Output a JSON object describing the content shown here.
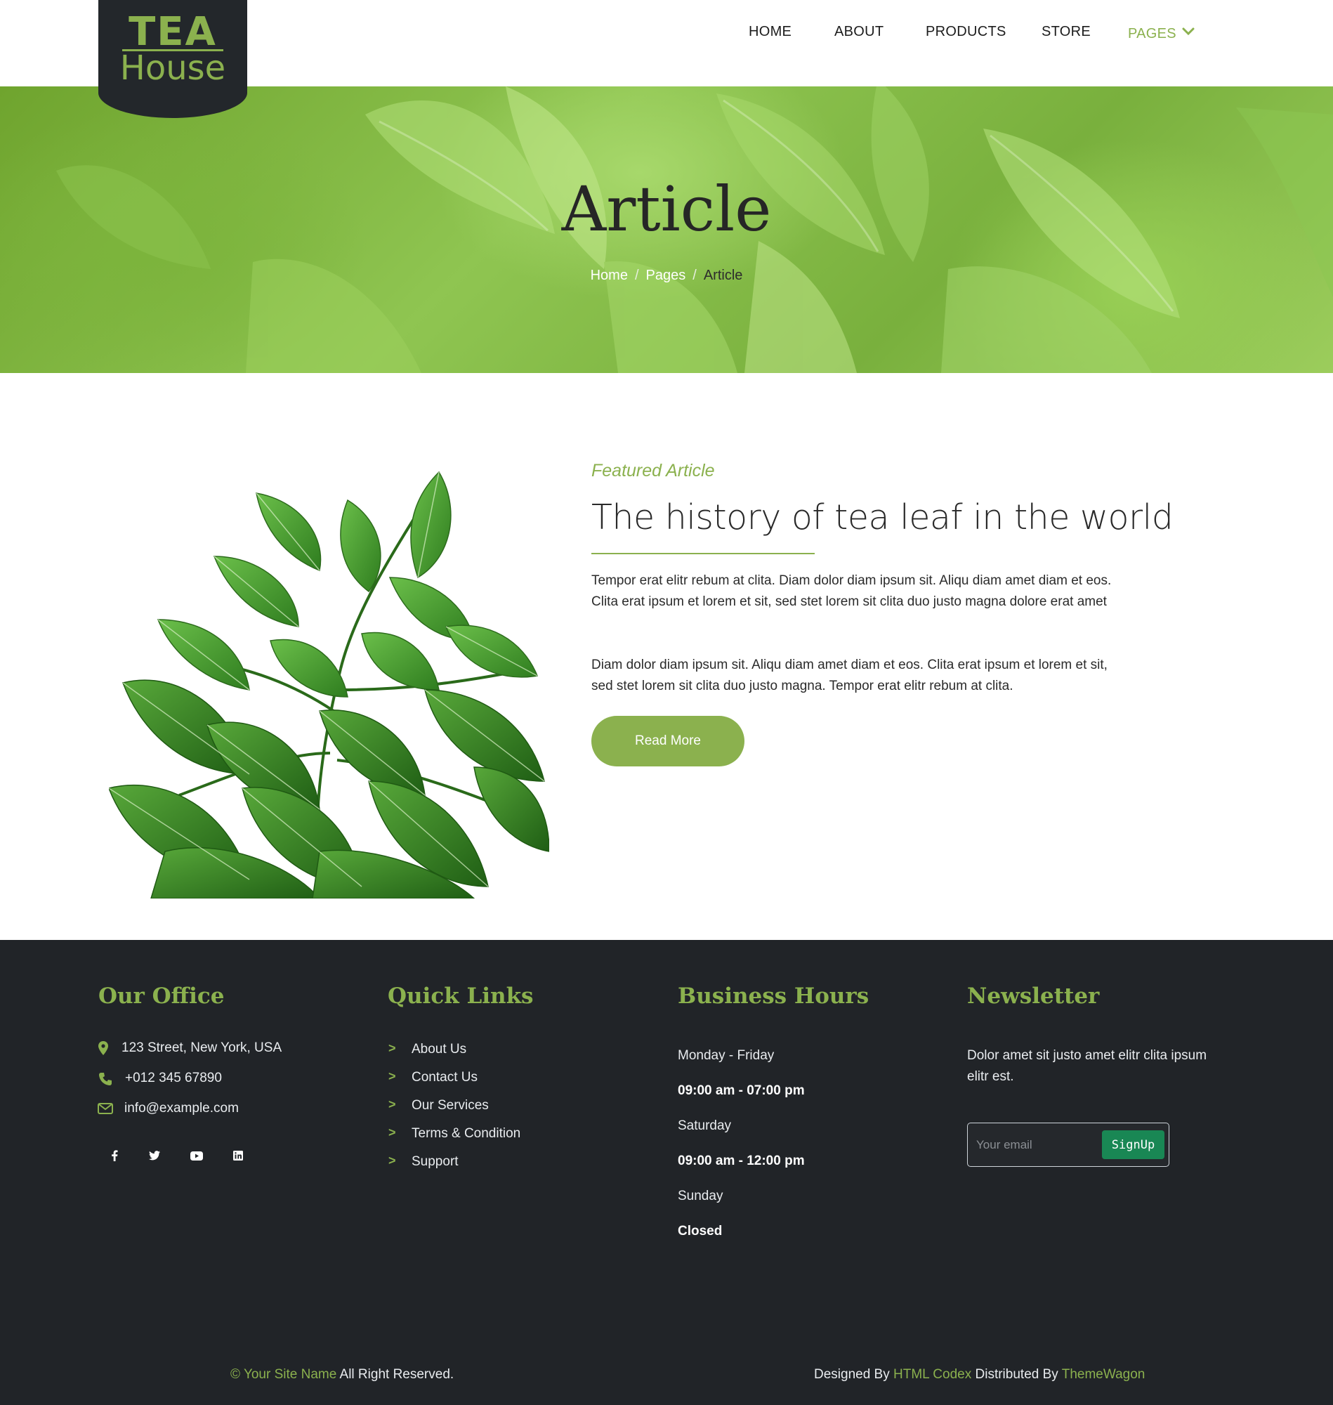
{
  "logo": {
    "line1": "TEA",
    "line2": "House"
  },
  "nav": {
    "items": [
      {
        "label": "HOME"
      },
      {
        "label": "ABOUT"
      },
      {
        "label": "PRODUCTS"
      },
      {
        "label": "STORE"
      },
      {
        "label": "PAGES"
      }
    ],
    "active_color": "#8bb14e"
  },
  "hero": {
    "title": "Article",
    "breadcrumb": {
      "home": "Home",
      "pages": "Pages",
      "current": "Article"
    }
  },
  "article": {
    "eyebrow": "Featured Article",
    "title": "The history of tea leaf in the world",
    "paragraph1": "Tempor erat elitr rebum at clita. Diam dolor diam ipsum sit. Aliqu diam amet diam et eos. Clita erat ipsum et lorem et sit, sed stet lorem sit clita duo justo magna dolore erat amet",
    "paragraph2": "Diam dolor diam ipsum sit. Aliqu diam amet diam et eos. Clita erat ipsum et lorem et sit, sed stet lorem sit clita duo justo magna. Tempor erat elitr rebum at clita.",
    "button": "Read More"
  },
  "footer": {
    "office": {
      "heading": "Our Office",
      "address": "123 Street, New York, USA",
      "phone": "+012 345 67890",
      "email": "info@example.com",
      "social": [
        "facebook-icon",
        "twitter-icon",
        "youtube-icon",
        "linkedin-icon"
      ]
    },
    "links": {
      "heading": "Quick Links",
      "items": [
        "About Us",
        "Contact Us",
        "Our Services",
        "Terms & Condition",
        "Support"
      ]
    },
    "hours": {
      "heading": "Business Hours",
      "rows": [
        {
          "day": "Monday - Friday",
          "time": "09:00 am - 07:00 pm"
        },
        {
          "day": "Saturday",
          "time": "09:00 am - 12:00 pm"
        },
        {
          "day": "Sunday",
          "time": "Closed"
        }
      ]
    },
    "newsletter": {
      "heading": "Newsletter",
      "text_line1": "Dolor amet sit justo amet elitr clita ipsum",
      "text_line2": "elitr est.",
      "placeholder": "Your email",
      "button": "SignUp"
    },
    "copyright": {
      "prefix": "© ",
      "site": "Your Site Name",
      "rest": " All Right Reserved."
    },
    "credits": {
      "designed": "Designed By ",
      "codex": "HTML Codex",
      "distributed": " Distributed By ",
      "wagon": "ThemeWagon"
    }
  },
  "colors": {
    "accent": "#8bb14e",
    "dark": "#212428",
    "signup": "#198754"
  }
}
